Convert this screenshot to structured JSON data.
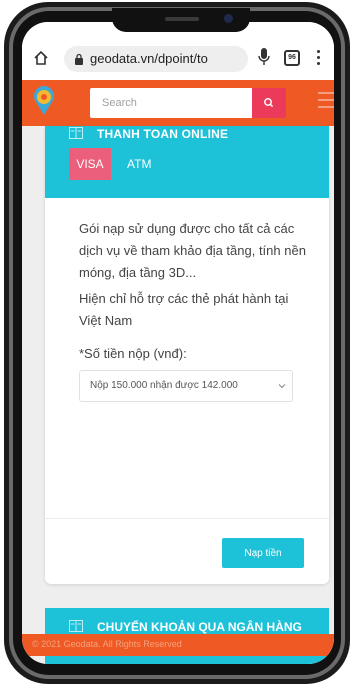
{
  "browser": {
    "url": "geodata.vn/dpoint/to",
    "tab_count": "96"
  },
  "header": {
    "search_placeholder": "Search"
  },
  "payment_card": {
    "title": "THANH TOAN ONLINE",
    "tabs": [
      {
        "label": "VISA",
        "active": true
      },
      {
        "label": "ATM",
        "active": false
      }
    ],
    "description": "Gói nạp sử dụng được cho tất cả các dịch vụ về tham khảo địa tầng, tính nền móng, địa tầng 3D...",
    "note": "Hiện chỉ hỗ trợ các thẻ phát hành tại Việt Nam",
    "amount_label": "*Số tiền nộp (vnđ):",
    "amount_selected": "Nộp 150.000 nhận được 142.000",
    "submit_label": "Nạp tiền"
  },
  "bank_card": {
    "title": "CHUYỂN KHOẢN QUA NGÂN HÀNG"
  },
  "footer": {
    "text": "© 2021 Geodata. All Rights Reserved"
  },
  "colors": {
    "brand_orange": "#ef5a24",
    "accent_cyan": "#1ec2d8",
    "accent_pink": "#ec3a5a",
    "tab_active": "#ec5f7c"
  }
}
